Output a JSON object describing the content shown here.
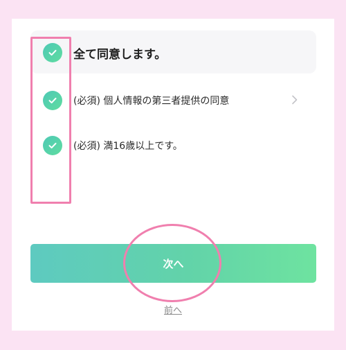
{
  "colors": {
    "page_background": "#fbe3f3",
    "card_background": "#ffffff",
    "accent_green": "#5fd4a8",
    "highlight_pink": "#f07fae"
  },
  "consent": {
    "agree_all_label": "全て同意します。",
    "items": [
      {
        "label": "(必須) 個人情報の第三者提供の同意",
        "checked": true,
        "has_detail_chevron": true
      },
      {
        "label": "(必須) 満16歳以上です。",
        "checked": true,
        "has_detail_chevron": false
      }
    ]
  },
  "actions": {
    "next_label": "次へ",
    "prev_label": "前へ"
  }
}
